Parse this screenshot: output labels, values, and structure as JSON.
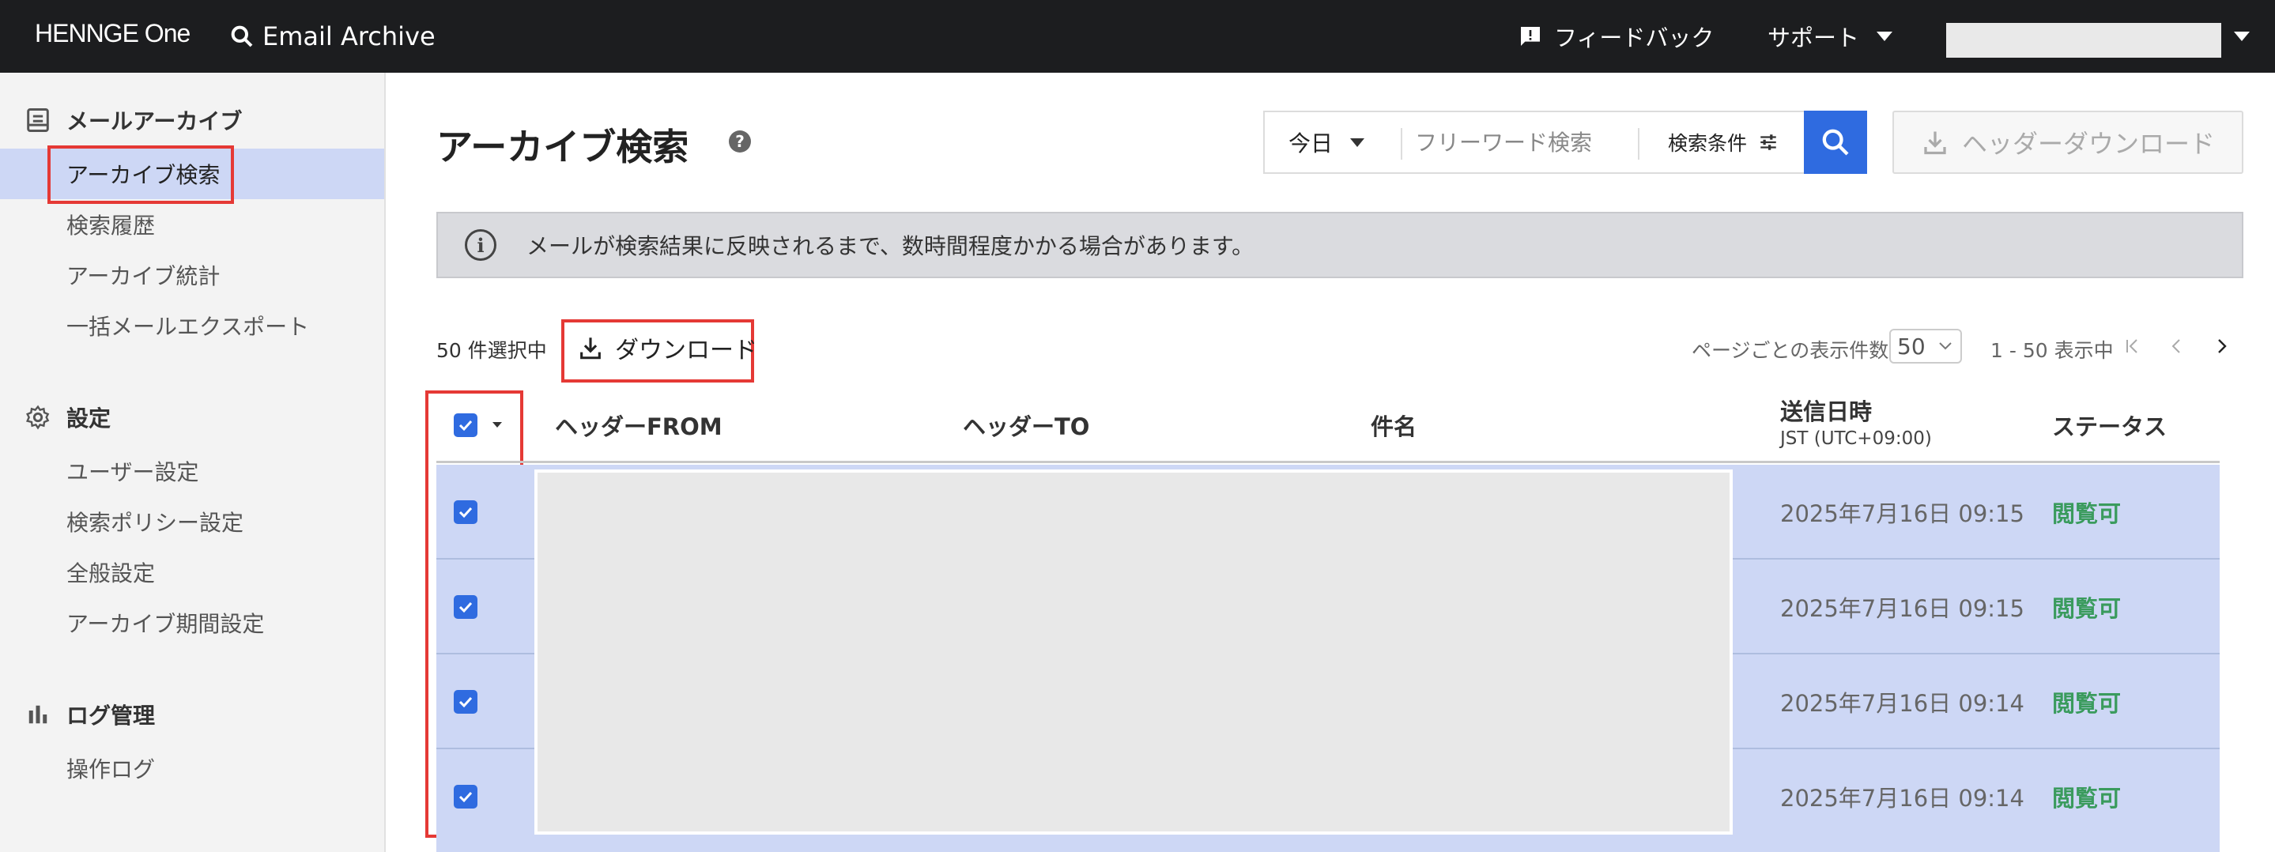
{
  "topbar": {
    "logo": "HENNGE One",
    "app_name": "Email Archive",
    "feedback": "フィードバック",
    "support": "サポート"
  },
  "sidebar": {
    "sections": [
      {
        "title": "メールアーカイブ",
        "icon": "archive-icon",
        "items": [
          "アーカイブ検索",
          "検索履歴",
          "アーカイブ統計",
          "一括メールエクスポート"
        ]
      },
      {
        "title": "設定",
        "icon": "gear-icon",
        "items": [
          "ユーザー設定",
          "検索ポリシー設定",
          "全般設定",
          "アーカイブ期間設定"
        ]
      },
      {
        "title": "ログ管理",
        "icon": "bar-chart-icon",
        "items": [
          "操作ログ"
        ]
      }
    ],
    "active_item": "アーカイブ検索"
  },
  "main": {
    "title": "アーカイブ検索",
    "help": "?",
    "search": {
      "date_value": "今日",
      "placeholder": "フリーワード検索",
      "conditions": "検索条件"
    },
    "header_download": "ヘッダーダウンロード",
    "notice": "メールが検索結果に反映されるまで、数時間程度かかる場合があります。",
    "selected_count": "50 件選択中",
    "download": "ダウンロード",
    "per_page_label": "ページごとの表示件数",
    "per_page_value": "50",
    "range": "1 - 50 表示中"
  },
  "table": {
    "columns": {
      "from": "ヘッダーFROM",
      "to": "ヘッダーTO",
      "subject": "件名",
      "sent": "送信日時",
      "sent_tz": "JST (UTC+09:00)",
      "status": "ステータス"
    },
    "rows": [
      {
        "date": "2025年7月16日 09:15",
        "status": "閲覧可",
        "checked": true
      },
      {
        "date": "2025年7月16日 09:15",
        "status": "閲覧可",
        "checked": true
      },
      {
        "date": "2025年7月16日 09:14",
        "status": "閲覧可",
        "checked": true
      },
      {
        "date": "2025年7月16日 09:14",
        "status": "閲覧可",
        "checked": true
      }
    ]
  },
  "colors": {
    "accent": "#2f6be0",
    "selected_row": "#cdd7f5",
    "status_ok": "#3a9b5d",
    "highlight_box": "#e53935"
  }
}
